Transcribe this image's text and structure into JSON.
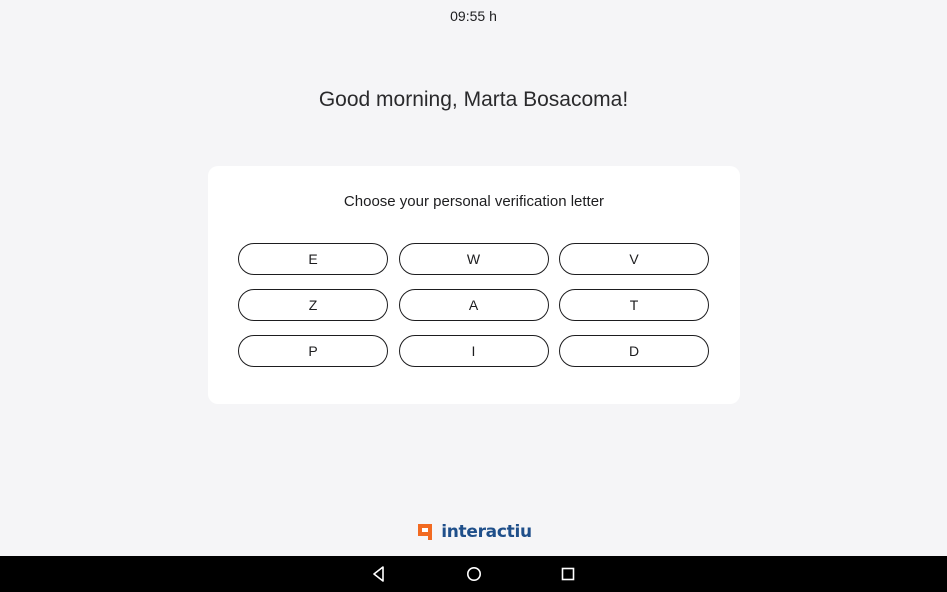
{
  "status": {
    "clock": "09:55 h"
  },
  "greeting": "Good morning, Marta Bosacoma!",
  "verification": {
    "title": "Choose your personal verification letter",
    "letters": [
      "E",
      "W",
      "V",
      "Z",
      "A",
      "T",
      "P",
      "I",
      "D"
    ]
  },
  "branding": {
    "logo_text": "interactiu",
    "logo_mark_color": "#f26a21",
    "logo_text_color": "#1f4f8a"
  },
  "navbar": {
    "icons": [
      "back-icon",
      "home-icon",
      "recents-icon"
    ]
  }
}
